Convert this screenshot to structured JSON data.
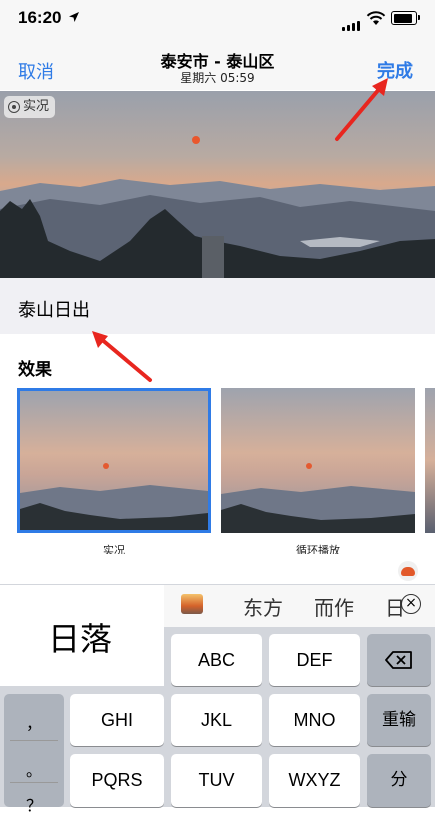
{
  "status_bar": {
    "time": "16:20"
  },
  "nav": {
    "cancel_label": "取消",
    "title": "泰安市 - 泰山区",
    "subtitle": "星期六  05:59",
    "done_label": "完成"
  },
  "photo": {
    "live_badge": "实况"
  },
  "caption": {
    "text": "泰山日出"
  },
  "effects": {
    "title": "效果",
    "items": [
      {
        "label": "实况",
        "selected": true
      },
      {
        "label": "循环播放",
        "selected": false
      }
    ]
  },
  "keyboard": {
    "input_text": "日落",
    "candidates": [
      "东方",
      "而作",
      "日"
    ],
    "keys": {
      "abc": "ABC",
      "def": "DEF",
      "ghi": "GHI",
      "jkl": "JKL",
      "mno": "MNO",
      "pqrs": "PQRS",
      "tuv": "TUV",
      "wxyz": "WXYZ",
      "enter": "重输",
      "next": "分"
    },
    "punctuation": [
      "，",
      "。",
      "？"
    ]
  },
  "colors": {
    "accent": "#2f7be6",
    "arrow": "#e8261f"
  }
}
